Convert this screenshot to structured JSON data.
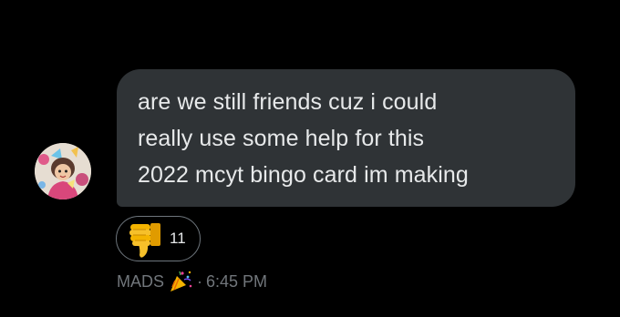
{
  "message": {
    "lines": [
      "are we still friends cuz i could",
      "really use some help for this",
      "2022 mcyt bingo card im making"
    ],
    "bubble_color": "#2f3336",
    "text_color": "#e7e9ea"
  },
  "reaction": {
    "icon": "thumbs-down-icon",
    "count": "11"
  },
  "meta": {
    "sender": "MADS",
    "emoji_icon": "party-popper-icon",
    "separator": "·",
    "time": "6:45 PM",
    "color": "#71767b"
  },
  "avatar": {
    "icon": "avatar-image"
  }
}
